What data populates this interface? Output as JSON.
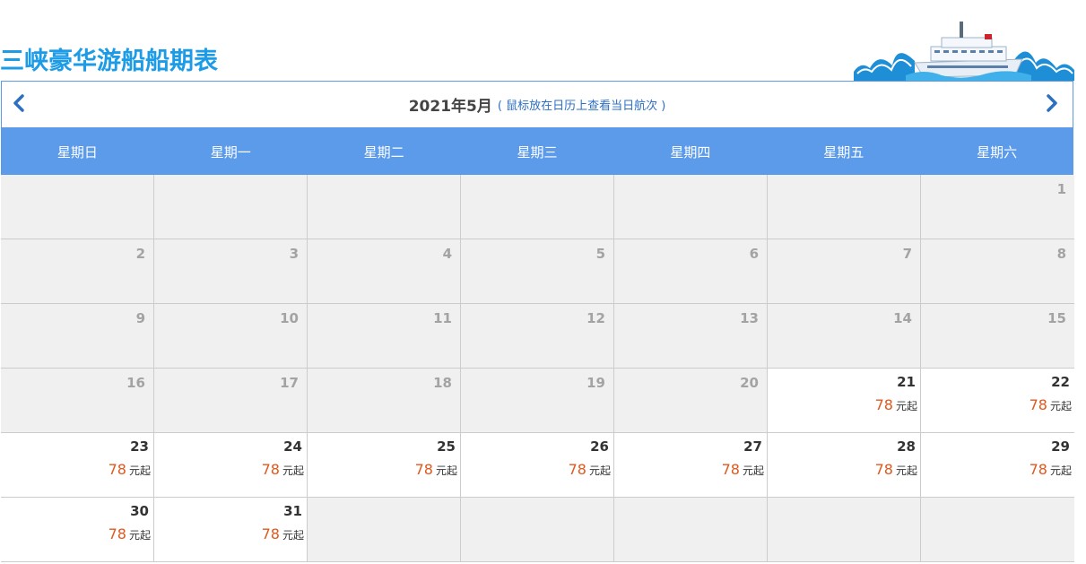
{
  "page": {
    "title": "三峡豪华游船船期表"
  },
  "calendar": {
    "month_label": "2021年5月",
    "hint": "( 鼠标放在日历上查看当日航次 )",
    "prev_label": "previous-month",
    "next_label": "next-month",
    "weekdays": [
      "星期日",
      "星期一",
      "星期二",
      "星期三",
      "星期四",
      "星期五",
      "星期六"
    ],
    "cells": [
      {
        "day": ""
      },
      {
        "day": ""
      },
      {
        "day": ""
      },
      {
        "day": ""
      },
      {
        "day": ""
      },
      {
        "day": ""
      },
      {
        "day": "1"
      },
      {
        "day": "2"
      },
      {
        "day": "3"
      },
      {
        "day": "4"
      },
      {
        "day": "5"
      },
      {
        "day": "6"
      },
      {
        "day": "7"
      },
      {
        "day": "8"
      },
      {
        "day": "9"
      },
      {
        "day": "10"
      },
      {
        "day": "11"
      },
      {
        "day": "12"
      },
      {
        "day": "13"
      },
      {
        "day": "14"
      },
      {
        "day": "15"
      },
      {
        "day": "16"
      },
      {
        "day": "17"
      },
      {
        "day": "18"
      },
      {
        "day": "19"
      },
      {
        "day": "20"
      },
      {
        "day": "21",
        "price": "78",
        "unit": "元起"
      },
      {
        "day": "22",
        "price": "78",
        "unit": "元起"
      },
      {
        "day": "23",
        "price": "78",
        "unit": "元起"
      },
      {
        "day": "24",
        "price": "78",
        "unit": "元起"
      },
      {
        "day": "25",
        "price": "78",
        "unit": "元起"
      },
      {
        "day": "26",
        "price": "78",
        "unit": "元起"
      },
      {
        "day": "27",
        "price": "78",
        "unit": "元起"
      },
      {
        "day": "28",
        "price": "78",
        "unit": "元起"
      },
      {
        "day": "29",
        "price": "78",
        "unit": "元起"
      },
      {
        "day": "30",
        "price": "78",
        "unit": "元起"
      },
      {
        "day": "31",
        "price": "78",
        "unit": "元起"
      },
      {
        "day": ""
      },
      {
        "day": ""
      },
      {
        "day": ""
      },
      {
        "day": ""
      },
      {
        "day": ""
      }
    ]
  },
  "colors": {
    "title": "#1c9be6",
    "header_bar": "#5b9bea",
    "inactive_cell": "#f0f0f0",
    "price": "#e1581f"
  },
  "icons": {
    "ship": "cruise-ship-icon",
    "prev": "chevron-left-icon",
    "next": "chevron-right-icon"
  }
}
